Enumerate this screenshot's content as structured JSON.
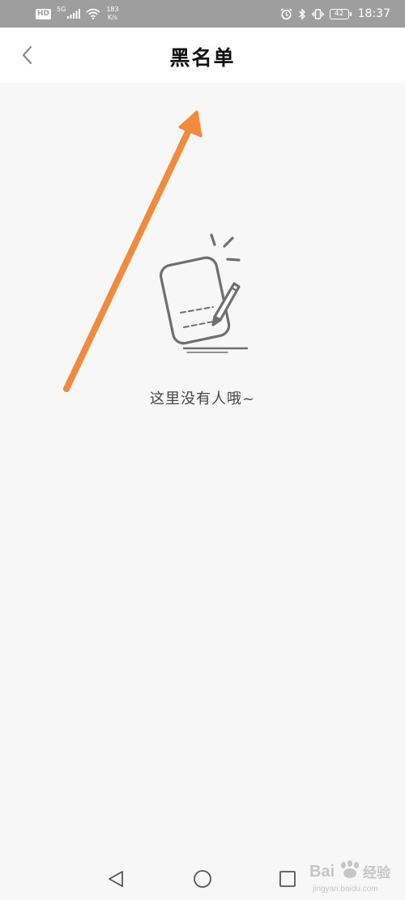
{
  "status_bar": {
    "hd_badge": "HD",
    "network_label": "5G",
    "speed_value": "183",
    "speed_unit": "K/s",
    "battery": "42",
    "time": "18:37",
    "icons": [
      "hd-icon",
      "signal-icon",
      "wifi-icon",
      "alarm-icon",
      "bluetooth-icon",
      "vibrate-icon",
      "battery-icon"
    ]
  },
  "header": {
    "title": "黑名单",
    "back_icon": "chevron-left-icon"
  },
  "empty_state": {
    "icon": "empty-note-pen-icon",
    "caption": "这里没有人哦~"
  },
  "annotation": {
    "type": "arrow",
    "color": "#f28a3c"
  },
  "nav_bar": {
    "buttons": [
      "back-triangle-icon",
      "home-circle-icon",
      "recents-square-icon"
    ]
  },
  "watermark": {
    "text": "Bai 经验",
    "url": "jingyan.baidu.com"
  },
  "colors": {
    "status_bar_bg": "#9e9e9e",
    "header_bg": "#ffffff",
    "page_bg": "#f7f7f7",
    "illustration": "#6f6f6f",
    "caption": "#444444"
  }
}
